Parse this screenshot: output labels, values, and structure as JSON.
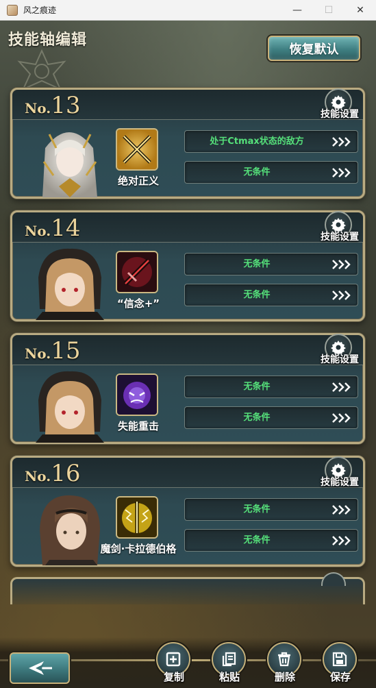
{
  "window": {
    "title": "风之痕迹",
    "controls": {
      "minimize": "—",
      "maximize": "☐",
      "close": "✕"
    }
  },
  "header": {
    "title": "技能轴编辑",
    "restore_label": "恢复默认"
  },
  "cards": [
    {
      "no_prefix": "No.",
      "number": "13",
      "gear_label": "技能设置",
      "skill_name": "绝对正义",
      "skill_icon": "crossed-swords-icon",
      "conditions": [
        "处于Ctmax状态的敌方",
        "无条件"
      ]
    },
    {
      "no_prefix": "No.",
      "number": "14",
      "gear_label": "技能设置",
      "skill_name": "“信念+”",
      "skill_icon": "crimson-blade-icon",
      "conditions": [
        "无条件",
        "无条件"
      ]
    },
    {
      "no_prefix": "No.",
      "number": "15",
      "gear_label": "技能设置",
      "skill_name": "失能重击",
      "skill_icon": "shadow-beast-icon",
      "conditions": [
        "无条件",
        "无条件"
      ]
    },
    {
      "no_prefix": "No.",
      "number": "16",
      "gear_label": "技能设置",
      "skill_name": "魔剑·卡拉德伯格",
      "skill_icon": "lightning-sword-icon",
      "conditions": [
        "无条件",
        "无条件"
      ]
    }
  ],
  "toolbar": {
    "copy_label": "复制",
    "paste_label": "粘贴",
    "delete_label": "删除",
    "save_label": "保存"
  },
  "colors": {
    "condition_text": "#55e07a",
    "number_gold": "#ebd49c",
    "frame_gold": "#b9ab82",
    "button_teal": "#3f7f82"
  }
}
